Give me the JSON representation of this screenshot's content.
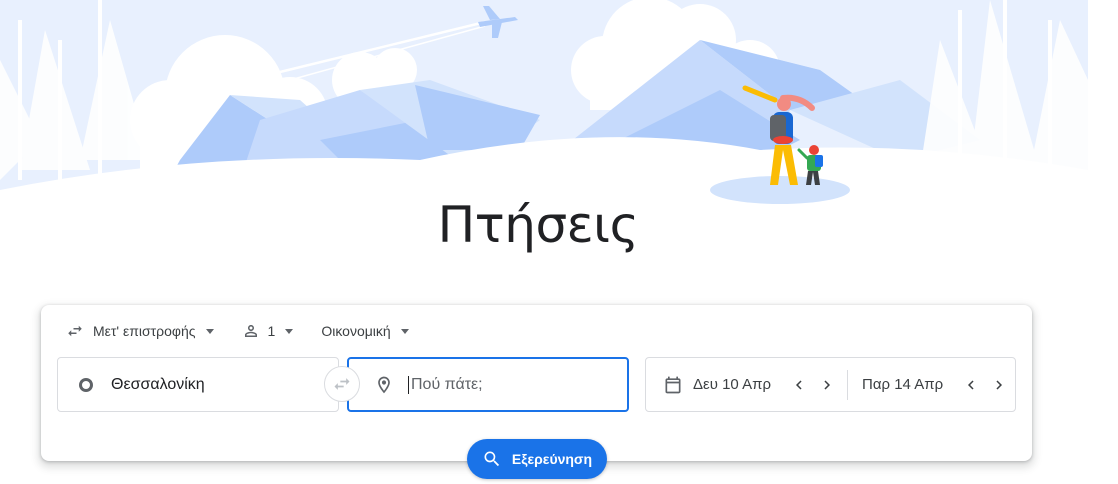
{
  "page": {
    "title": "Πτήσεις"
  },
  "search": {
    "trip_type": "Μετ' επιστροφής",
    "passengers": "1",
    "cabin_class": "Οικονομική",
    "origin": "Θεσσαλονίκη",
    "destination_placeholder": "Πού πάτε;",
    "depart_date": "Δευ 10 Απρ",
    "return_date": "Παρ 14 Απρ",
    "explore_label": "Εξερεύνηση"
  },
  "colors": {
    "accent": "#1a73e8",
    "hero_sky": "#e8f0fe",
    "hero_mountain": "#aecbfa"
  },
  "icons": {
    "trip_type": "swap-horiz-icon",
    "passengers": "person-icon",
    "origin": "circle-icon",
    "swap": "swap-icon",
    "destination": "location-pin-icon",
    "calendar": "calendar-icon",
    "explore": "search-icon"
  }
}
